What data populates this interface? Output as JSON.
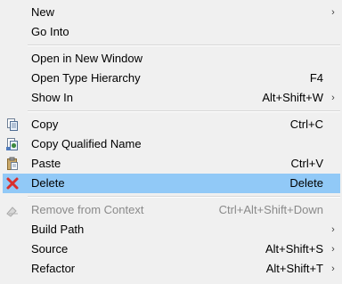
{
  "menu": {
    "items": [
      {
        "label": "New",
        "shortcut": "",
        "submenu": true
      },
      {
        "label": "Go Into",
        "shortcut": "",
        "submenu": false
      },
      {
        "label": "Open in New Window",
        "shortcut": "",
        "submenu": false
      },
      {
        "label": "Open Type Hierarchy",
        "shortcut": "F4",
        "submenu": false
      },
      {
        "label": "Show In",
        "shortcut": "Alt+Shift+W",
        "submenu": true
      },
      {
        "label": "Copy",
        "shortcut": "Ctrl+C",
        "icon": "copy-icon"
      },
      {
        "label": "Copy Qualified Name",
        "shortcut": "",
        "icon": "copy-qualified-name-icon"
      },
      {
        "label": "Paste",
        "shortcut": "Ctrl+V",
        "icon": "paste-icon"
      },
      {
        "label": "Delete",
        "shortcut": "Delete",
        "icon": "delete-icon",
        "selected": true
      },
      {
        "label": "Remove from Context",
        "shortcut": "Ctrl+Alt+Shift+Down",
        "icon": "remove-from-context-icon",
        "disabled": true
      },
      {
        "label": "Build Path",
        "shortcut": "",
        "submenu": true
      },
      {
        "label": "Source",
        "shortcut": "Alt+Shift+S",
        "submenu": true
      },
      {
        "label": "Refactor",
        "shortcut": "Alt+Shift+T",
        "submenu": true
      }
    ],
    "submenu_arrow": "›",
    "colors": {
      "background": "#f0f0f0",
      "selected": "#91c9f7",
      "separator": "#d7d7d7",
      "disabled_text": "#8a8a8a",
      "delete_icon": "#d9302c"
    }
  }
}
